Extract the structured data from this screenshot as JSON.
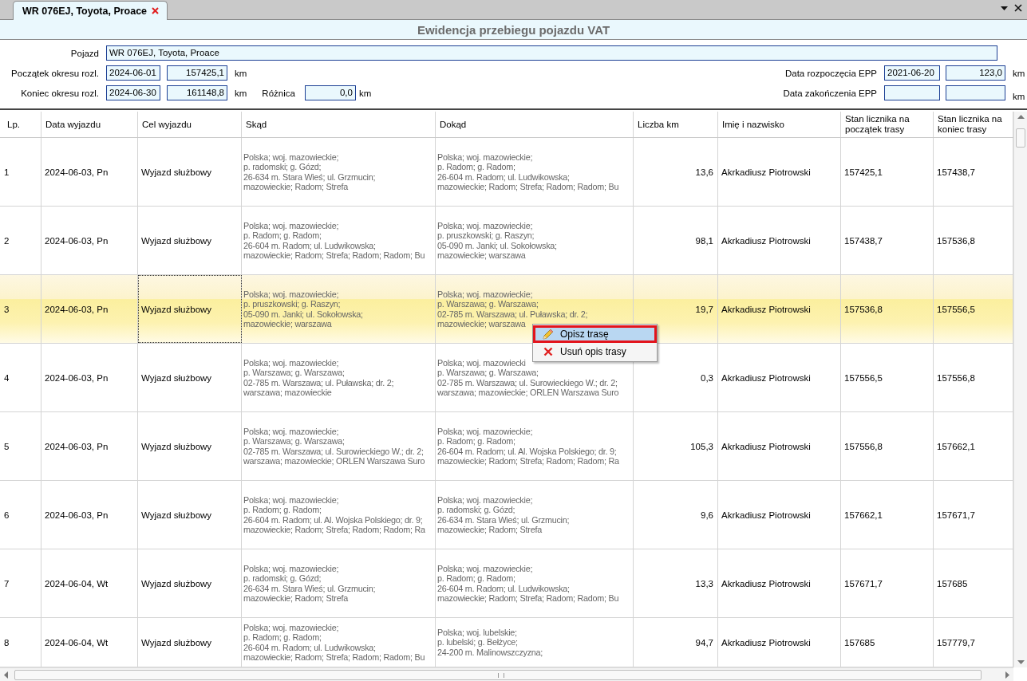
{
  "tab": {
    "label": "WR 076EJ, Toyota, Proace",
    "selected": true
  },
  "title": "Ewidencja przebiegu pojazdu VAT",
  "form": {
    "vehicle": {
      "label": "Pojazd",
      "value": "WR 076EJ, Toyota, Proace"
    },
    "period_start": {
      "label": "Początek okresu rozl.",
      "date": "2024-06-01",
      "km": "157425,1",
      "unit": "km"
    },
    "period_end": {
      "label": "Koniec okresu rozl.",
      "date": "2024-06-30",
      "km": "161148,8",
      "unit": "km",
      "diff_label": "Różnica",
      "diff": "0,0",
      "diff_unit": "km"
    },
    "epp_start": {
      "label": "Data rozpoczęcia EPP",
      "date": "2021-06-20",
      "km": "123,0",
      "unit": "km"
    },
    "epp_end": {
      "label": "Data zakończenia EPP",
      "unit": "km"
    }
  },
  "table": {
    "columns": [
      "Lp.",
      "Data wyjazdu",
      "Cel wyjazdu",
      "Skąd",
      "Dokąd",
      "Liczba km",
      "Imię i nazwisko",
      "Stan licznika na początek trasy",
      "Stan licznika na koniec trasy"
    ],
    "rows": [
      {
        "lp": "1",
        "date": "2024-06-03, Pn",
        "purpose": "Wyjazd służbowy",
        "from": [
          "Polska; woj. mazowieckie;",
          "p. radomski; g. Gózd;",
          "26-634 m. Stara Wieś; ul. Grzmucin;",
          "mazowieckie; Radom; Strefa"
        ],
        "to": [
          "Polska; woj. mazowieckie;",
          "p. Radom; g. Radom;",
          "26-604 m. Radom; ul. Ludwikowska;",
          "mazowieckie; Radom; Strefa; Radom; Radom; Bu"
        ],
        "km": "13,6",
        "driver": "Akrkadiusz Piotrowski",
        "odo_start": "157425,1",
        "odo_end": "157438,7",
        "selected": false
      },
      {
        "lp": "2",
        "date": "2024-06-03, Pn",
        "purpose": "Wyjazd służbowy",
        "from": [
          "Polska; woj. mazowieckie;",
          "p. Radom; g. Radom;",
          "26-604 m. Radom; ul. Ludwikowska;",
          "mazowieckie; Radom; Strefa; Radom; Radom; Bu"
        ],
        "to": [
          "Polska; woj. mazowieckie;",
          "p. pruszkowski; g. Raszyn;",
          "05-090 m. Janki; ul. Sokołowska;",
          "mazowieckie; warszawa"
        ],
        "km": "98,1",
        "driver": "Akrkadiusz Piotrowski",
        "odo_start": "157438,7",
        "odo_end": "157536,8",
        "selected": false
      },
      {
        "lp": "3",
        "date": "2024-06-03, Pn",
        "purpose": "Wyjazd służbowy",
        "from": [
          "Polska; woj. mazowieckie;",
          "p. pruszkowski; g. Raszyn;",
          "05-090 m. Janki; ul. Sokołowska;",
          "mazowieckie; warszawa"
        ],
        "to": [
          "Polska; woj. mazowieckie;",
          "p. Warszawa; g. Warszawa;",
          "02-785 m. Warszawa; ul. Puławska; dr. 2;",
          "mazowieckie; warszawa"
        ],
        "km": "19,7",
        "driver": "Akrkadiusz Piotrowski",
        "odo_start": "157536,8",
        "odo_end": "157556,5",
        "selected": true
      },
      {
        "lp": "4",
        "date": "2024-06-03, Pn",
        "purpose": "Wyjazd służbowy",
        "from": [
          "Polska; woj. mazowieckie;",
          "p. Warszawa; g. Warszawa;",
          "02-785 m. Warszawa; ul. Puławska; dr. 2;",
          "warszawa; mazowieckie"
        ],
        "to": [
          "Polska; woj. mazowiecki",
          "p. Warszawa; g. Warszawa;",
          "02-785 m. Warszawa; ul. Surowieckiego W.; dr. 2;",
          "warszawa; mazowieckie; ORLEN Warszawa Suro"
        ],
        "km": "0,3",
        "driver": "Akrkadiusz Piotrowski",
        "odo_start": "157556,5",
        "odo_end": "157556,8",
        "selected": false
      },
      {
        "lp": "5",
        "date": "2024-06-03, Pn",
        "purpose": "Wyjazd służbowy",
        "from": [
          "Polska; woj. mazowieckie;",
          "p. Warszawa; g. Warszawa;",
          "02-785 m. Warszawa; ul. Surowieckiego W.; dr. 2;",
          "warszawa; mazowieckie; ORLEN Warszawa Suro"
        ],
        "to": [
          "Polska; woj. mazowieckie;",
          "p. Radom; g. Radom;",
          "26-604 m. Radom; ul. Al. Wojska Polskiego; dr. 9;",
          "mazowieckie; Radom; Strefa; Radom; Radom; Ra"
        ],
        "km": "105,3",
        "driver": "Akrkadiusz Piotrowski",
        "odo_start": "157556,8",
        "odo_end": "157662,1",
        "selected": false
      },
      {
        "lp": "6",
        "date": "2024-06-03, Pn",
        "purpose": "Wyjazd służbowy",
        "from": [
          "Polska; woj. mazowieckie;",
          "p. Radom; g. Radom;",
          "26-604 m. Radom; ul. Al. Wojska Polskiego; dr. 9;",
          "mazowieckie; Radom; Strefa; Radom; Radom; Ra"
        ],
        "to": [
          "Polska; woj. mazowieckie;",
          "p. radomski; g. Gózd;",
          "26-634 m. Stara Wieś; ul. Grzmucin;",
          "mazowieckie; Radom; Strefa"
        ],
        "km": "9,6",
        "driver": "Akrkadiusz Piotrowski",
        "odo_start": "157662,1",
        "odo_end": "157671,7",
        "selected": false
      },
      {
        "lp": "7",
        "date": "2024-06-04, Wt",
        "purpose": "Wyjazd służbowy",
        "from": [
          "Polska; woj. mazowieckie;",
          "p. radomski; g. Gózd;",
          "26-634 m. Stara Wieś; ul. Grzmucin;",
          "mazowieckie; Radom; Strefa"
        ],
        "to": [
          "Polska; woj. mazowieckie;",
          "p. Radom; g. Radom;",
          "26-604 m. Radom; ul. Ludwikowska;",
          "mazowieckie; Radom; Strefa; Radom; Radom; Bu"
        ],
        "km": "13,3",
        "driver": "Akrkadiusz Piotrowski",
        "odo_start": "157671,7",
        "odo_end": "157685",
        "selected": false
      },
      {
        "lp": "8",
        "date": "2024-06-04, Wt",
        "purpose": "Wyjazd służbowy",
        "from": [
          "Polska; woj. mazowieckie;",
          "p. Radom; g. Radom;",
          "26-604 m. Radom; ul. Ludwikowska;",
          "mazowieckie; Radom; Strefa; Radom; Radom; Bu"
        ],
        "to": [
          "Polska; woj. lubelskie;",
          "p. lubelski; g. Bełżyce;",
          "24-200 m. Malinowszczyzna;"
        ],
        "km": "94,7",
        "driver": "Akrkadiusz Piotrowski",
        "odo_start": "157685",
        "odo_end": "157779,7",
        "selected": false
      }
    ]
  },
  "context_menu": [
    {
      "label": "Opisz trasę",
      "kind": "edit",
      "highlighted": true
    },
    {
      "label": "Usuń opis trasy",
      "kind": "delete",
      "highlighted": false
    }
  ]
}
